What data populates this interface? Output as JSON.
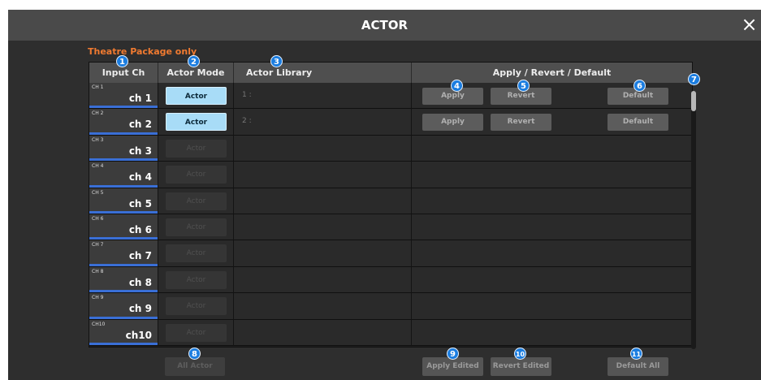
{
  "window": {
    "title": "ACTOR",
    "close_icon": "×"
  },
  "package_note": "Theatre Package only",
  "headers": {
    "input_ch": "Input Ch",
    "actor_mode": "Actor Mode",
    "actor_library": "Actor Library",
    "apply_revert_default": "Apply / Revert / Default"
  },
  "channels": [
    {
      "num": "CH 1",
      "name": "ch 1",
      "mode": "Actor",
      "mode_on": true,
      "library": "1 :",
      "apply": "Apply",
      "revert": "Revert",
      "default": "Default",
      "has_buttons": true
    },
    {
      "num": "CH 2",
      "name": "ch 2",
      "mode": "Actor",
      "mode_on": true,
      "library": "2 :",
      "apply": "Apply",
      "revert": "Revert",
      "default": "Default",
      "has_buttons": true
    },
    {
      "num": "CH 3",
      "name": "ch 3",
      "mode": "Actor",
      "mode_on": false,
      "library": "",
      "has_buttons": false
    },
    {
      "num": "CH 4",
      "name": "ch 4",
      "mode": "Actor",
      "mode_on": false,
      "library": "",
      "has_buttons": false
    },
    {
      "num": "CH 5",
      "name": "ch 5",
      "mode": "Actor",
      "mode_on": false,
      "library": "",
      "has_buttons": false
    },
    {
      "num": "CH 6",
      "name": "ch 6",
      "mode": "Actor",
      "mode_on": false,
      "library": "",
      "has_buttons": false
    },
    {
      "num": "CH 7",
      "name": "ch 7",
      "mode": "Actor",
      "mode_on": false,
      "library": "",
      "has_buttons": false
    },
    {
      "num": "CH 8",
      "name": "ch 8",
      "mode": "Actor",
      "mode_on": false,
      "library": "",
      "has_buttons": false
    },
    {
      "num": "CH 9",
      "name": "ch 9",
      "mode": "Actor",
      "mode_on": false,
      "library": "",
      "has_buttons": false
    },
    {
      "num": "CH10",
      "name": "ch10",
      "mode": "Actor",
      "mode_on": false,
      "library": "",
      "has_buttons": false
    }
  ],
  "bottom": {
    "all_actor": "All Actor",
    "apply_edited": "Apply Edited",
    "revert_edited": "Revert Edited",
    "default_all": "Default All"
  },
  "callouts": [
    "1",
    "2",
    "3",
    "4",
    "5",
    "6",
    "7",
    "8",
    "9",
    "10",
    "11"
  ],
  "colors": {
    "accent_blue": "#1b7de0",
    "actor_on": "#a8dcf7",
    "package_note": "#f07a30",
    "channel_bar": "#3a6fd6"
  }
}
